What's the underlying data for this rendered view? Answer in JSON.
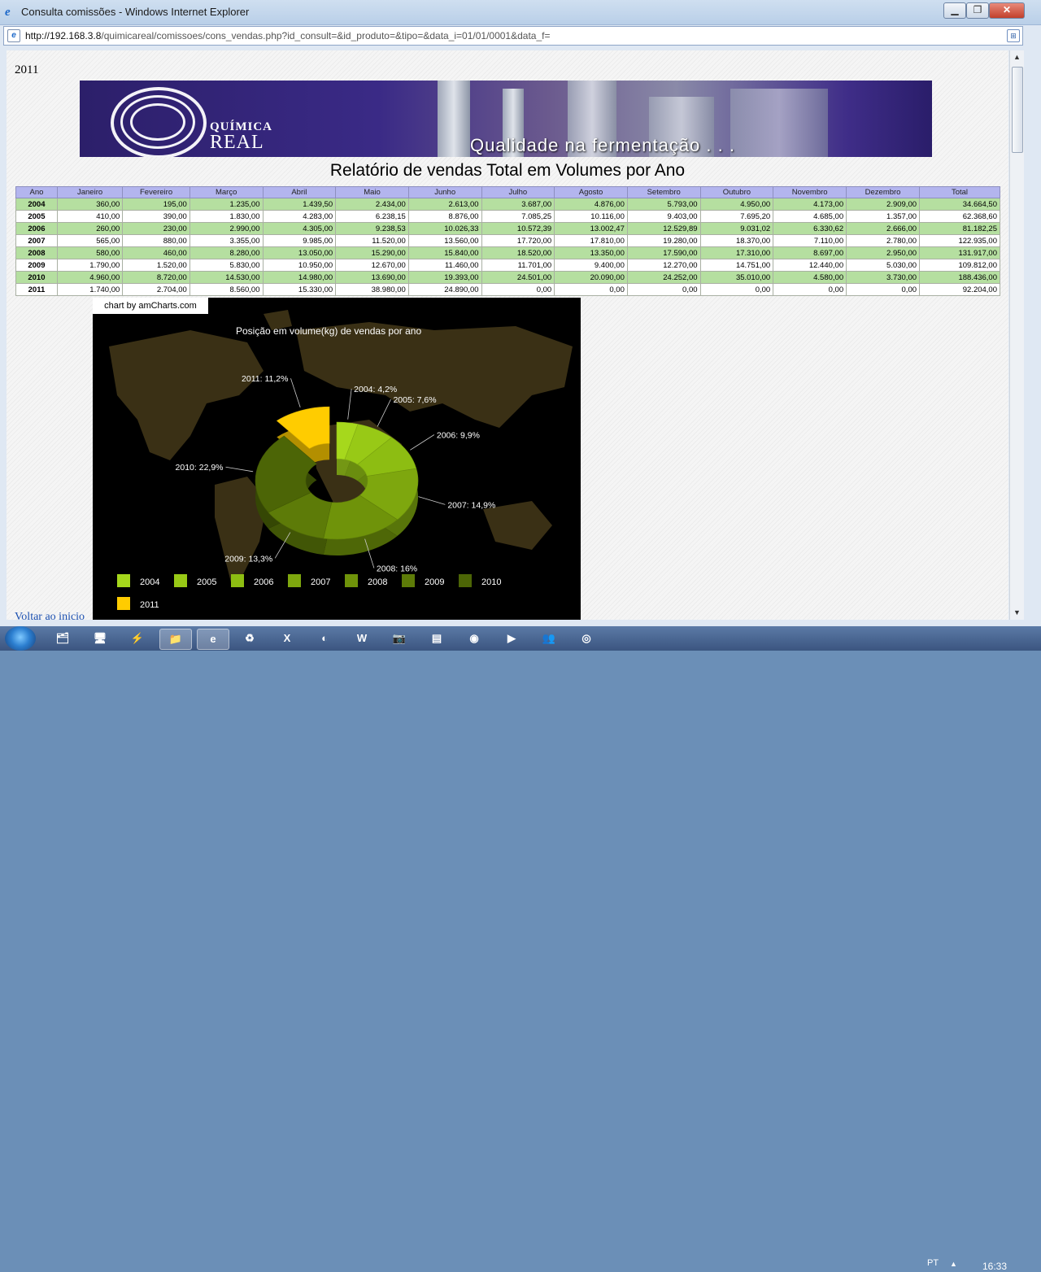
{
  "window": {
    "title": "Consulta comissões - Windows Internet Explorer",
    "url_host": "http://192.168.3.8",
    "url_path": "/quimicareal/comissoes/cons_vendas.php?id_consult=&id_produto=&tipo=&data_i=01/01/0001&data_f=",
    "minimize": "▁",
    "maximize": "❐",
    "close": "✕"
  },
  "page": {
    "year_heading": "2011",
    "logo_line1": "QUÍMICA",
    "logo_line2": "REAL",
    "slogan": "Qualidade na fermentação . . .",
    "report_title": "Relatório de vendas Total em Volumes por Ano",
    "back_link": "Voltar ao inicio"
  },
  "table": {
    "headers": [
      "Ano",
      "Janeiro",
      "Fevereiro",
      "Março",
      "Abril",
      "Maio",
      "Junho",
      "Julho",
      "Agosto",
      "Setembro",
      "Outubro",
      "Novembro",
      "Dezembro",
      "Total"
    ],
    "rows": [
      [
        "2004",
        "360,00",
        "195,00",
        "1.235,00",
        "1.439,50",
        "2.434,00",
        "2.613,00",
        "3.687,00",
        "4.876,00",
        "5.793,00",
        "4.950,00",
        "4.173,00",
        "2.909,00",
        "34.664,50"
      ],
      [
        "2005",
        "410,00",
        "390,00",
        "1.830,00",
        "4.283,00",
        "6.238,15",
        "8.876,00",
        "7.085,25",
        "10.116,00",
        "9.403,00",
        "7.695,20",
        "4.685,00",
        "1.357,00",
        "62.368,60"
      ],
      [
        "2006",
        "260,00",
        "230,00",
        "2.990,00",
        "4.305,00",
        "9.238,53",
        "10.026,33",
        "10.572,39",
        "13.002,47",
        "12.529,89",
        "9.031,02",
        "6.330,62",
        "2.666,00",
        "81.182,25"
      ],
      [
        "2007",
        "565,00",
        "880,00",
        "3.355,00",
        "9.985,00",
        "11.520,00",
        "13.560,00",
        "17.720,00",
        "17.810,00",
        "19.280,00",
        "18.370,00",
        "7.110,00",
        "2.780,00",
        "122.935,00"
      ],
      [
        "2008",
        "580,00",
        "460,00",
        "8.280,00",
        "13.050,00",
        "15.290,00",
        "15.840,00",
        "18.520,00",
        "13.350,00",
        "17.590,00",
        "17.310,00",
        "8.697,00",
        "2.950,00",
        "131.917,00"
      ],
      [
        "2009",
        "1.790,00",
        "1.520,00",
        "5.830,00",
        "10.950,00",
        "12.670,00",
        "11.460,00",
        "11.701,00",
        "9.400,00",
        "12.270,00",
        "14.751,00",
        "12.440,00",
        "5.030,00",
        "109.812,00"
      ],
      [
        "2010",
        "4.960,00",
        "8.720,00",
        "14.530,00",
        "14.980,00",
        "13.690,00",
        "19.393,00",
        "24.501,00",
        "20.090,00",
        "24.252,00",
        "35.010,00",
        "4.580,00",
        "3.730,00",
        "188.436,00"
      ],
      [
        "2011",
        "1.740,00",
        "2.704,00",
        "8.560,00",
        "15.330,00",
        "38.980,00",
        "24.890,00",
        "0,00",
        "0,00",
        "0,00",
        "0,00",
        "0,00",
        "0,00",
        "92.204,00"
      ]
    ]
  },
  "chart": {
    "credit": "chart by amCharts.com"
  },
  "chart_data": {
    "type": "pie",
    "title": "Posição em volume(kg) de vendas  por ano",
    "categories": [
      "2004",
      "2005",
      "2006",
      "2007",
      "2008",
      "2009",
      "2010",
      "2011"
    ],
    "values": [
      4.2,
      7.6,
      9.9,
      14.9,
      16,
      13.3,
      22.9,
      11.2
    ],
    "labels": [
      "2004: 4,2%",
      "2005: 7,6%",
      "2006: 9,9%",
      "2007: 14,9%",
      "2008: 16%",
      "2009: 13,3%",
      "2010: 22,9%",
      "2011: 11,2%"
    ],
    "colors": [
      "#a6d81c",
      "#98c916",
      "#8dbd12",
      "#7ea70e",
      "#6f930a",
      "#5d7b08",
      "#4c6506",
      "#ffcc00"
    ],
    "pulled_out": "2011",
    "legend": "bottom",
    "style": "3d donut"
  },
  "taskbar": {
    "apps": [
      "🗂",
      "🖥",
      "⚡",
      "📁",
      "e",
      "♻",
      "X",
      "◐",
      "W",
      "📷",
      "▤",
      "◉",
      "▶",
      "👥",
      "◎"
    ],
    "language": "PT",
    "tray_arrow": "▲",
    "time": "16:33"
  }
}
